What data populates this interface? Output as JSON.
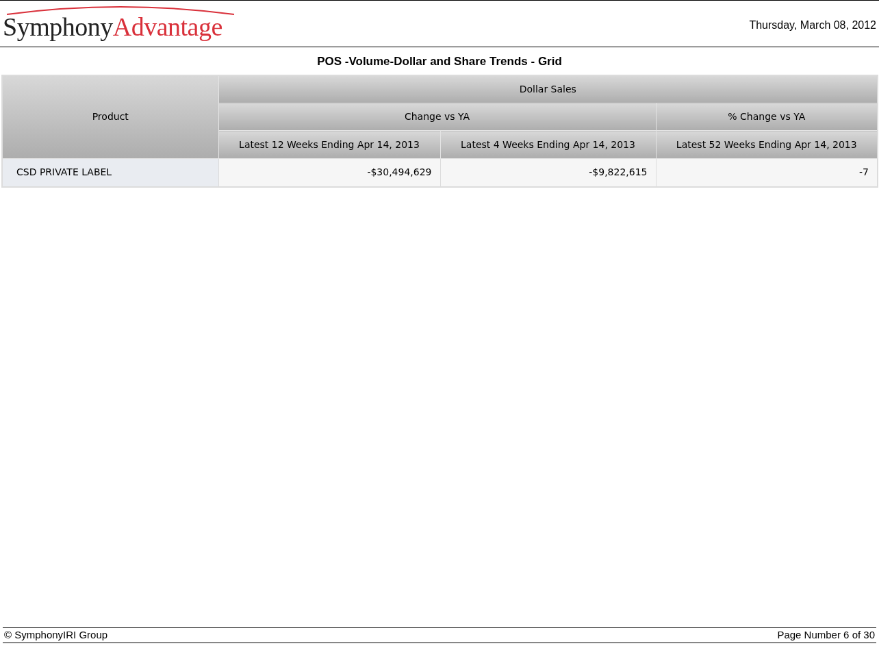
{
  "header": {
    "logo": {
      "first": "Symphony",
      "second": "Advantage"
    },
    "date": "Thursday, March 08, 2012"
  },
  "report_title": "POS -Volume-Dollar and Share Trends - Grid",
  "table": {
    "row_header": "Product",
    "group": "Dollar Sales",
    "subgroups": [
      {
        "label": "Change vs YA",
        "columns": [
          "Latest 12 Weeks Ending Apr 14, 2013",
          "Latest 4 Weeks Ending Apr 14, 2013"
        ]
      },
      {
        "label": "% Change vs YA",
        "columns": [
          "Latest 52 Weeks Ending Apr 14, 2013"
        ]
      }
    ],
    "rows": [
      {
        "product": "CSD PRIVATE LABEL",
        "values": [
          "-$30,494,629",
          "-$9,822,615",
          "-7"
        ]
      }
    ]
  },
  "footer": {
    "copyright": "© SymphonyIRI Group",
    "page": "Page Number 6 of 30"
  }
}
